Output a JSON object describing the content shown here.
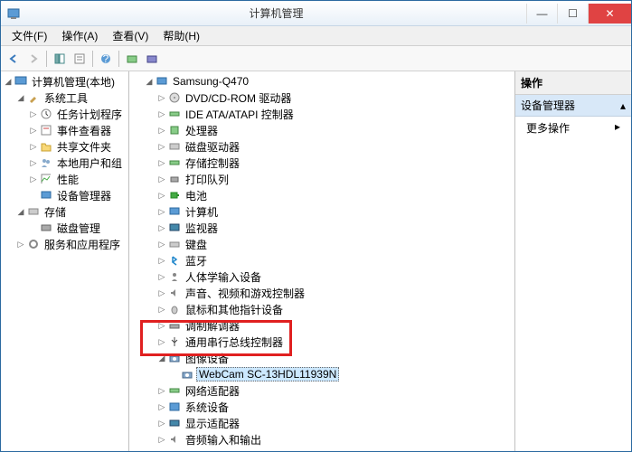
{
  "window": {
    "title": "计算机管理"
  },
  "winbtns": {
    "min": "—",
    "max": "☐",
    "close": "✕"
  },
  "menu": {
    "file": "文件(F)",
    "action": "操作(A)",
    "view": "查看(V)",
    "help": "帮助(H)"
  },
  "left_tree": {
    "root": "计算机管理(本地)",
    "sys_tools": "系统工具",
    "task_sched": "任务计划程序",
    "event_viewer": "事件查看器",
    "shared_folders": "共享文件夹",
    "local_users": "本地用户和组",
    "performance": "性能",
    "device_mgr": "设备管理器",
    "storage": "存储",
    "disk_mgmt": "磁盘管理",
    "services": "服务和应用程序"
  },
  "mid_tree": {
    "computer": "Samsung-Q470",
    "dvd": "DVD/CD-ROM 驱动器",
    "ide": "IDE ATA/ATAPI 控制器",
    "cpu": "处理器",
    "disk_drives": "磁盘驱动器",
    "storage_ctrl": "存储控制器",
    "print_queues": "打印队列",
    "battery": "电池",
    "computer_cat": "计算机",
    "monitors": "监视器",
    "keyboards": "键盘",
    "bluetooth": "蓝牙",
    "hid": "人体学输入设备",
    "sound": "声音、视频和游戏控制器",
    "mice": "鼠标和其他指针设备",
    "modems": "调制解调器",
    "usb": "通用串行总线控制器",
    "imaging": "图像设备",
    "webcam": "WebCam SC-13HDL11939N",
    "network": "网络适配器",
    "system_dev": "系统设备",
    "display": "显示适配器",
    "audio_io": "音频输入和输出"
  },
  "actions": {
    "header": "操作",
    "sub": "设备管理器",
    "more": "更多操作"
  }
}
